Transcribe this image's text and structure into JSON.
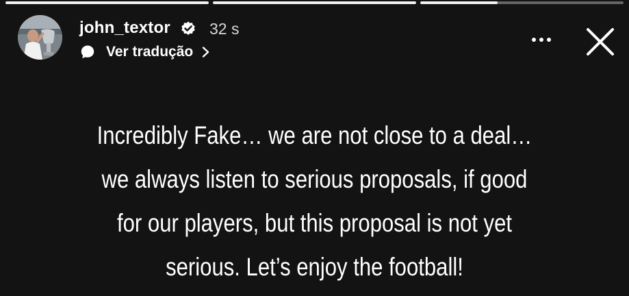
{
  "progress_bars": [
    {
      "fill": 1.0
    },
    {
      "fill": 1.0
    },
    {
      "fill": 0.38
    }
  ],
  "header": {
    "username": "john_textor",
    "time": "32 s",
    "translate_label": "Ver tradução",
    "verified": true
  },
  "icons": {
    "avatar": "profile-photo",
    "verified": "verified-badge-icon",
    "translate": "speech-bubble-icon",
    "chevron": "chevron-right-icon",
    "more": "more-dots-icon",
    "close": "close-icon"
  },
  "story": {
    "lines": [
      "Incredibly Fake… we are not close to a deal…",
      "we always listen to serious proposals, if good",
      "for our players, but this proposal is not yet",
      "serious. Let’s enjoy the football!"
    ]
  },
  "colors": {
    "background": "#131313",
    "text": "#ffffff"
  }
}
